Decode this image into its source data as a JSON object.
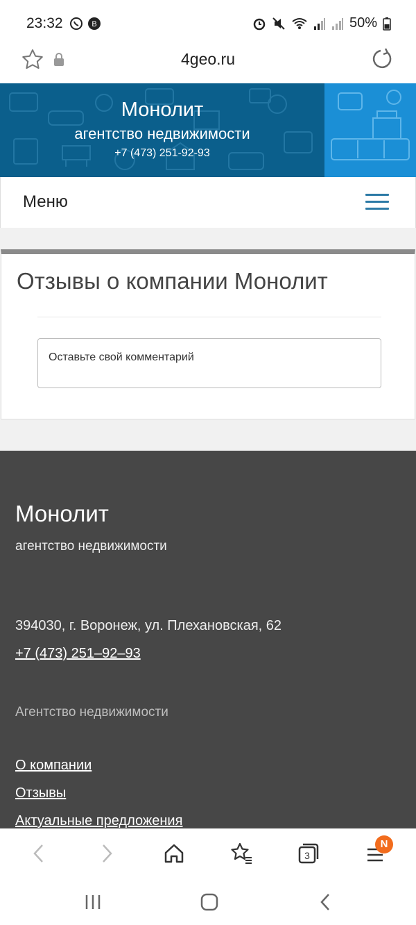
{
  "status_bar": {
    "time": "23:32",
    "battery": "50%",
    "icons": [
      "whatsapp-icon",
      "vk-icon",
      "alarm-icon",
      "mute-icon",
      "wifi-icon",
      "signal-icon",
      "signal-icon",
      "battery-icon"
    ]
  },
  "browser": {
    "url": "4geo.ru",
    "icons": [
      "star-icon",
      "lock-icon",
      "reload-icon"
    ],
    "toolbar": {
      "icons": [
        "back-icon",
        "forward-icon",
        "home-icon",
        "bookmarks-icon",
        "tabs-icon",
        "menu-icon"
      ],
      "tabs_count": "3",
      "notification_badge": "N"
    }
  },
  "banner": {
    "title": "Монолит",
    "subtitle": "агентство недвижимости",
    "phone": "+7 (473) 251-92-93",
    "colors": {
      "primary": "#0b5f8c",
      "accent": "#1b8fd6"
    }
  },
  "menu": {
    "label": "Меню"
  },
  "reviews": {
    "title": "Отзывы о компании Монолит",
    "comment_placeholder": "Оставьте свой комментарий"
  },
  "footer": {
    "title": "Монолит",
    "subtitle": "агентство недвижимости",
    "address": "394030, г. Воронеж, ул. Плехановская, 62",
    "phone": "+7 (473) 251–92–93",
    "section_heading": "Агентство недвижимости",
    "links": [
      "О компании",
      "Отзывы",
      "Актуальные предложения"
    ],
    "background": "#474747"
  },
  "android_nav": {
    "icons": [
      "recents-icon",
      "home-icon",
      "back-icon"
    ]
  }
}
